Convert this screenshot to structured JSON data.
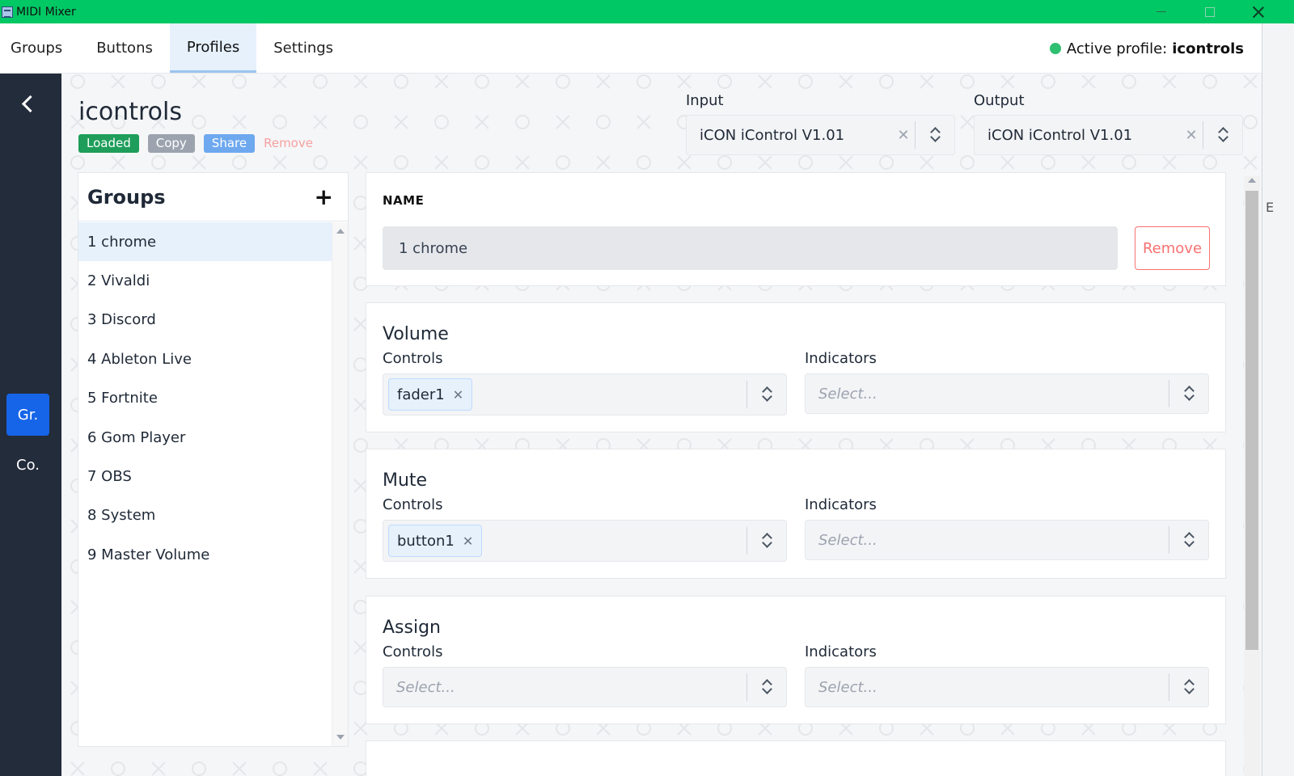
{
  "window": {
    "title": "MIDI Mixer"
  },
  "nav": {
    "tabs": [
      "Groups",
      "Buttons",
      "Profiles",
      "Settings"
    ],
    "active_tab": "Profiles",
    "active_profile_label": "Active profile:",
    "active_profile_name": "icontrols"
  },
  "sidebar": {
    "gr_label": "Gr.",
    "co_label": "Co."
  },
  "profile": {
    "name": "icontrols",
    "badges": {
      "loaded": "Loaded",
      "copy": "Copy",
      "share": "Share",
      "remove": "Remove"
    },
    "input_label": "Input",
    "input_value": "iCON iControl V1.01",
    "output_label": "Output",
    "output_value": "iCON iControl V1.01"
  },
  "groups": {
    "title": "Groups",
    "add_symbol": "+",
    "items": [
      "1 chrome",
      "2 Vivaldi",
      "3 Discord",
      "4 Ableton Live",
      "5 Fortnite",
      "6 Gom Player",
      "7 OBS",
      "8 System",
      "9 Master Volume"
    ],
    "selected": "1 chrome"
  },
  "group_detail": {
    "name_label": "NAME",
    "name_value": "1 chrome",
    "remove_label": "Remove",
    "controls_label": "Controls",
    "indicators_label": "Indicators",
    "placeholder": "Select...",
    "sections": [
      {
        "title": "Volume",
        "control_chip": "fader1"
      },
      {
        "title": "Mute",
        "control_chip": "button1"
      },
      {
        "title": "Assign",
        "control_chip": ""
      }
    ]
  },
  "right_strip": {
    "glyph": "E"
  },
  "colors": {
    "titlebar": "#00c864",
    "sidebar": "#232c3b",
    "accent": "#1665e8",
    "status": "#2fbf71",
    "danger": "#f87171"
  }
}
